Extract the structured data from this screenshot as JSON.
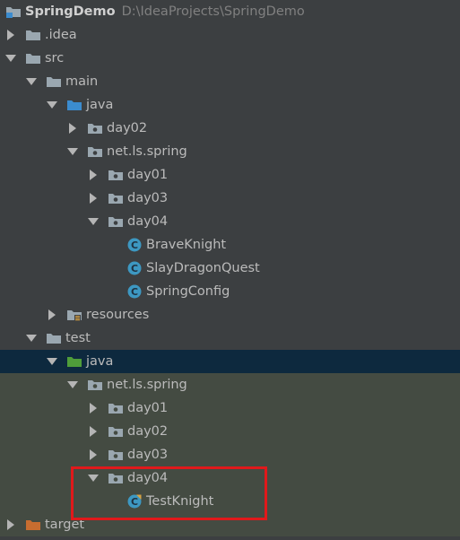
{
  "project": {
    "name": "SpringDemo",
    "path": "D:\\IdeaProjects\\SpringDemo"
  },
  "tree": {
    "idea": ".idea",
    "src": "src",
    "main": "main",
    "main_java": "java",
    "main_day02": "day02",
    "main_pkg": "net.ls.spring",
    "main_day01": "day01",
    "main_day03": "day03",
    "main_day04": "day04",
    "brave": "BraveKnight",
    "slay": "SlayDragonQuest",
    "config": "SpringConfig",
    "resources": "resources",
    "test": "test",
    "test_java": "java",
    "test_pkg": "net.ls.spring",
    "test_day01": "day01",
    "test_day02": "day02",
    "test_day03": "day03",
    "test_day04": "day04",
    "test_knight": "TestKnight",
    "target": "target"
  },
  "colors": {
    "background": "#3c3f41",
    "selection": "#0d293e",
    "test_scope": "#444b42",
    "highlight_border": "#e0191b",
    "folder": "#a9b7c6",
    "source_folder": "#3b8ccf",
    "test_folder": "#4f9d3a",
    "class_icon": "#3d98c2",
    "excluded_folder": "#c76d30"
  }
}
